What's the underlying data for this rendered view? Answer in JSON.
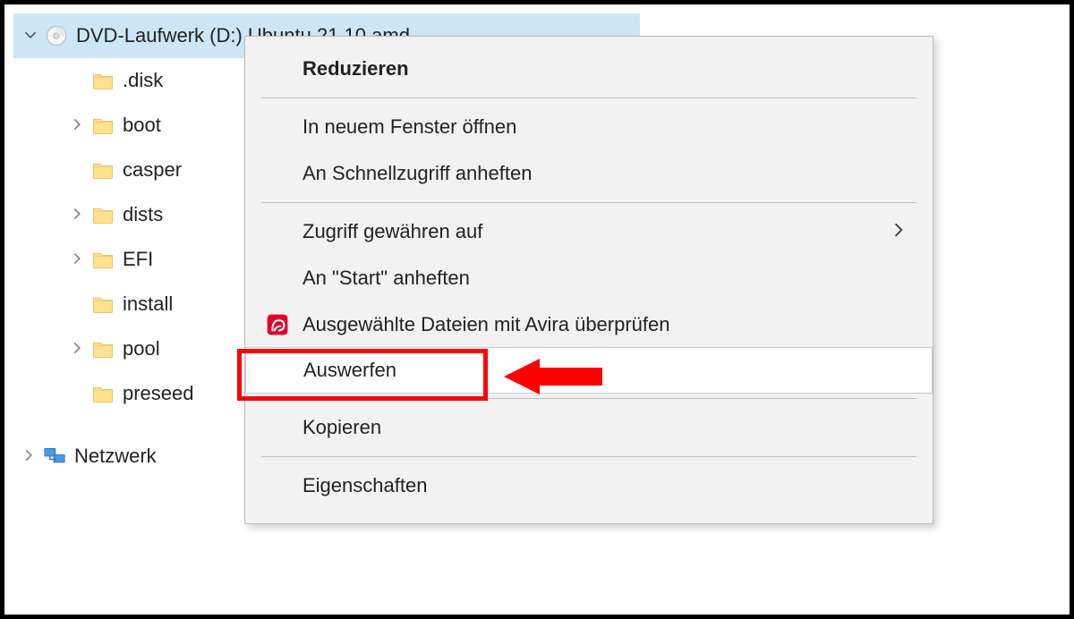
{
  "tree": {
    "drive_label": "DVD-Laufwerk (D:) Ubuntu 21.10 amd...",
    "folders": [
      {
        "name": ".disk",
        "expandable": false
      },
      {
        "name": "boot",
        "expandable": true
      },
      {
        "name": "casper",
        "expandable": false
      },
      {
        "name": "dists",
        "expandable": true
      },
      {
        "name": "EFI",
        "expandable": true
      },
      {
        "name": "install",
        "expandable": false
      },
      {
        "name": "pool",
        "expandable": true
      },
      {
        "name": "preseed",
        "expandable": false
      }
    ],
    "network_label": "Netzwerk"
  },
  "menu": {
    "reduce": "Reduzieren",
    "open_new_window": "In neuem Fenster öffnen",
    "pin_quick_access": "An Schnellzugriff anheften",
    "grant_access": "Zugriff gewähren auf",
    "pin_start": "An \"Start\" anheften",
    "avira_scan": "Ausgewählte Dateien mit Avira überprüfen",
    "eject": "Auswerfen",
    "copy": "Kopieren",
    "properties": "Eigenschaften"
  },
  "annotation": {
    "highlighted_item": "eject"
  }
}
